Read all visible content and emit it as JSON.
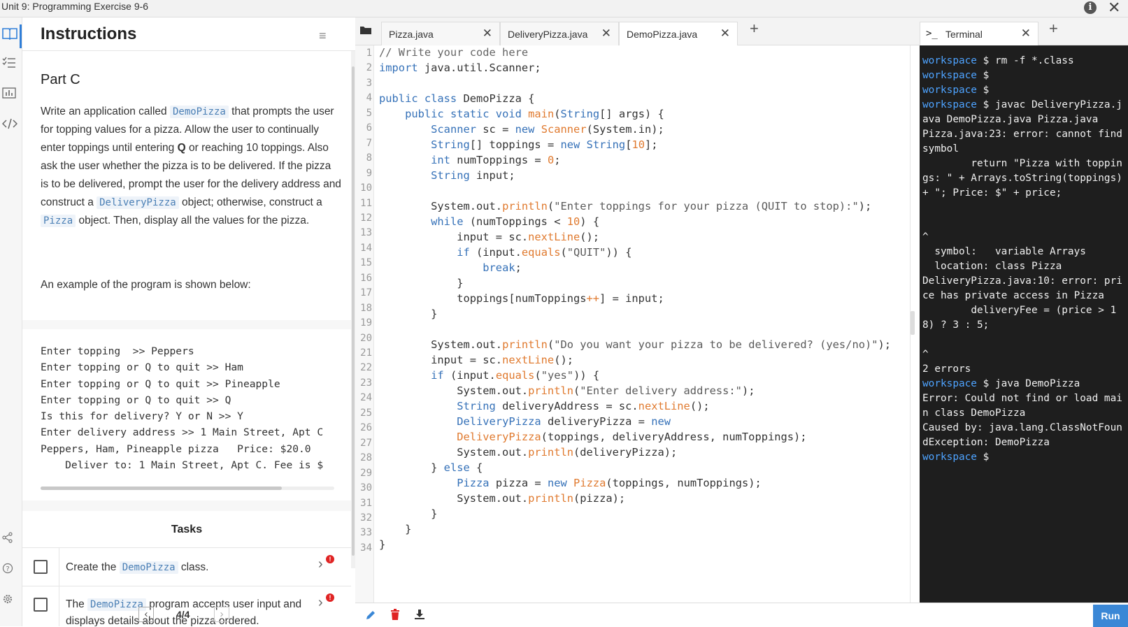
{
  "window": {
    "title": "Unit 9: Programming Exercise 9-6",
    "info_icon": "i",
    "close_icon": "✕"
  },
  "instructions": {
    "header_title": "Instructions",
    "menu_icon": "≡",
    "part_title": "Part C",
    "desc_1": "Write an application called ",
    "desc_class": "DemoPizza",
    "desc_2": " that prompts the user for topping values for a pizza. Allow the user to continually enter toppings until entering ",
    "desc_q": "Q",
    "desc_3": " or reaching 10 toppings. Also ask the user whether the pizza is to be delivered. If the pizza is to be delivered, prompt the user for the delivery address and construct a ",
    "desc_delivery": "DeliveryPizza",
    "desc_4": " object; otherwise, construct a ",
    "desc_pizza": "Pizza",
    "desc_5": " object. Then, display all the values for the pizza.",
    "example_intro": "An example of the program is shown below:",
    "sample": "Enter topping  >> Peppers\nEnter topping or Q to quit >> Ham\nEnter topping or Q to quit >> Pineapple\nEnter topping or Q to quit >> Q\nIs this for delivery? Y or N >> Y\nEnter delivery address >> 1 Main Street, Apt C\nPeppers, Ham, Pineapple pizza   Price: $20.0\n    Deliver to: 1 Main Street, Apt C. Fee is $",
    "tasks_title": "Tasks",
    "task1_a": "Create the ",
    "task1_code": "DemoPizza",
    "task1_b": " class.",
    "task2_a": "The ",
    "task2_code": "DemoPizza",
    "task2_b": " program accepts user input and displays details about the pizza ordered.",
    "task_alert": "!",
    "pager_prev": "‹",
    "pager_text": "4/4",
    "pager_next": "›"
  },
  "editor": {
    "tabs": [
      "Pizza.java",
      "DeliveryPizza.java",
      "DemoPizza.java"
    ],
    "tab_close": "✕",
    "add_tab": "+",
    "line_numbers": [
      "1",
      "2",
      "3",
      "4",
      "5",
      "6",
      "7",
      "8",
      "9",
      "10",
      "11",
      "12",
      "13",
      "14",
      "15",
      "16",
      "17",
      "18",
      "19",
      "20",
      "21",
      "22",
      "23",
      "24",
      "25",
      "26",
      "27",
      "28",
      "29",
      "30",
      "31",
      "32",
      "33",
      "34"
    ]
  },
  "terminal": {
    "tab_prompt": ">_",
    "tab_label": "Terminal",
    "tab_close": "✕",
    "add_tab": "+",
    "prompt_word": "workspace",
    "run_label": "Run"
  },
  "colors": {
    "accent": "#3a87d6",
    "keyword": "#3571b8",
    "method": "#e07a2f",
    "alert": "#e02424",
    "terminal_bg": "#1e1e1e"
  }
}
